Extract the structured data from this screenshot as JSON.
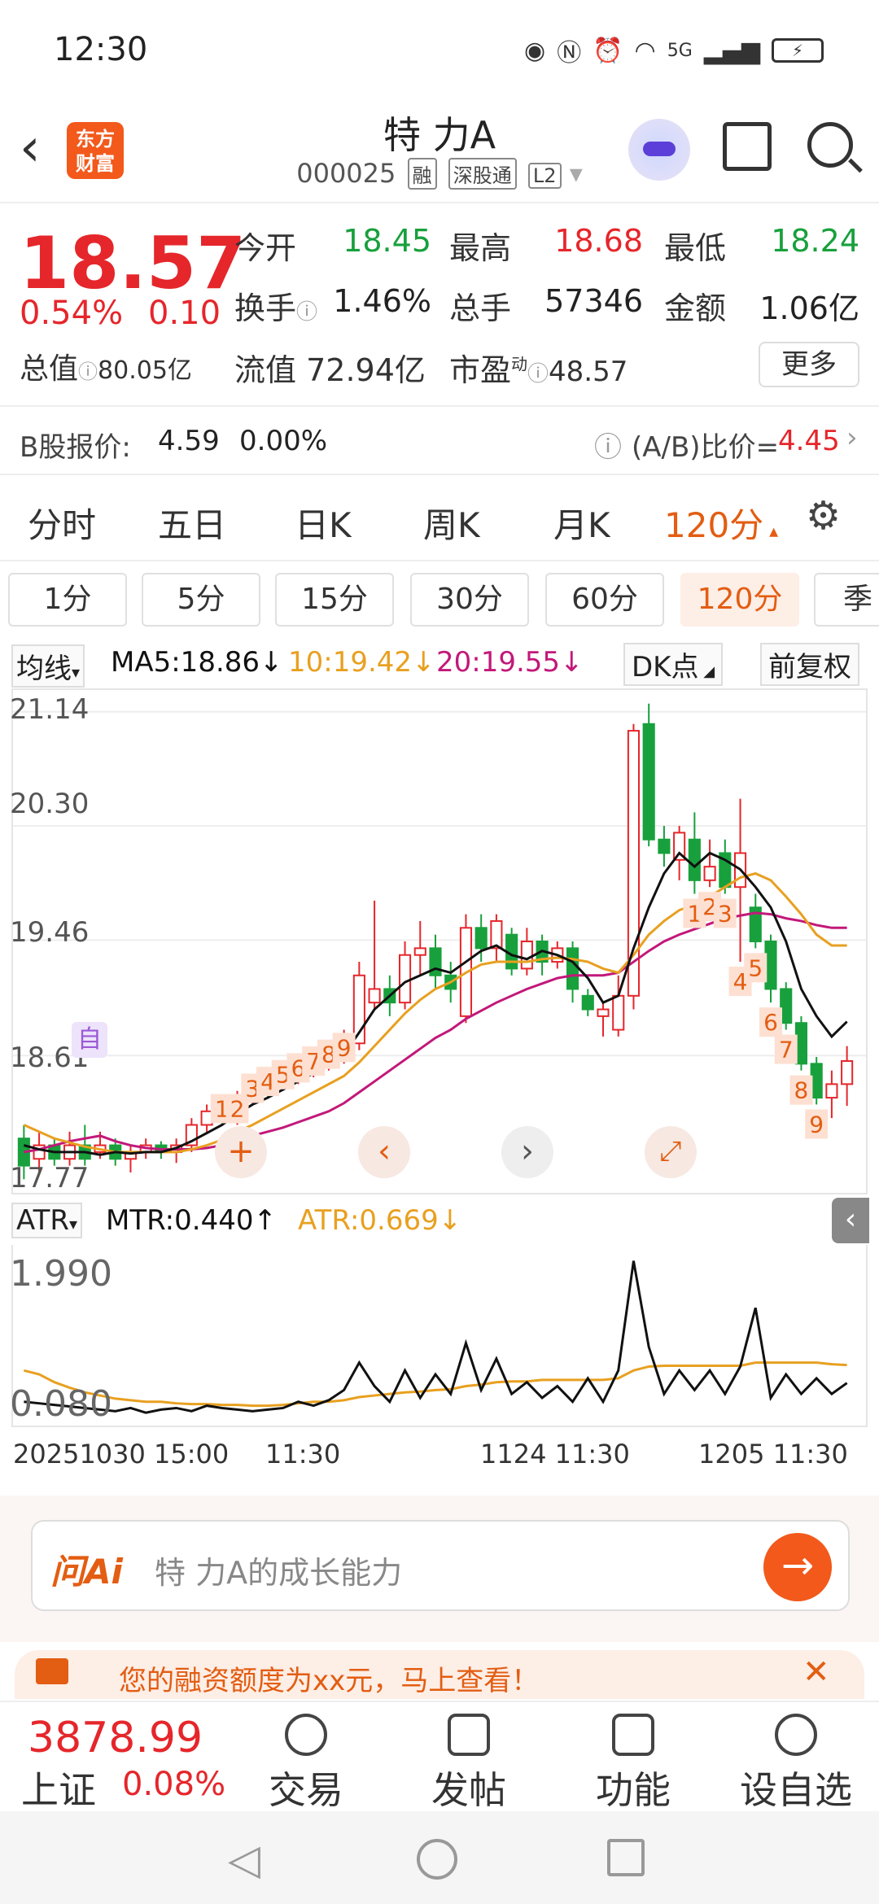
{
  "status": {
    "time": "12:30",
    "net": "5G"
  },
  "header": {
    "title": "特 力A",
    "code": "000025",
    "tags": [
      "融",
      "深股通",
      "L2"
    ],
    "logo": [
      "东方",
      "财富"
    ]
  },
  "quote": {
    "price": "18.57",
    "pct": "0.54%",
    "change": "0.10",
    "fields": [
      {
        "label": "今开",
        "value": "18.45",
        "color": "green"
      },
      {
        "label": "最高",
        "value": "18.68",
        "color": "red"
      },
      {
        "label": "最低",
        "value": "18.24",
        "color": "green"
      },
      {
        "label": "换手",
        "value": "1.46%",
        "color": "dark"
      },
      {
        "label": "总手",
        "value": "57346",
        "color": "dark"
      },
      {
        "label": "金额",
        "value": "1.06亿",
        "color": "dark"
      }
    ],
    "total_value_label": "总值",
    "total_value": "80.05亿",
    "float_label": "流值",
    "float_value": "72.94亿",
    "pe_label": "市盈",
    "pe_sup": "动",
    "pe_value": "48.57",
    "more": "更多"
  },
  "bshare": {
    "label": "B股报价:",
    "price": "4.59",
    "pct": "0.00%",
    "ratio_label": "(A/B)比价=",
    "ratio": "4.45"
  },
  "tabs": [
    "分时",
    "五日",
    "日K",
    "周K",
    "月K",
    "120分"
  ],
  "active_tab": "120分",
  "subtabs": [
    "1分",
    "5分",
    "15分",
    "30分",
    "60分",
    "120分",
    "季"
  ],
  "ma_legend": {
    "selector": "均线",
    "ma5": "MA5:18.86",
    "ma5_arrow": "↓",
    "ma10": "10:19.42",
    "ma10_arrow": "↓",
    "ma20": "20:19.55",
    "ma20_arrow": "↓",
    "dk": "DK点",
    "fq": "前复权"
  },
  "price_axis": [
    "21.14",
    "20.30",
    "19.46",
    "18.61",
    "17.77"
  ],
  "self_mark": "自",
  "atr_legend": {
    "selector": "ATR",
    "mtr": "MTR:0.440",
    "mtr_arrow": "↑",
    "atr": "ATR:0.669",
    "atr_arrow": "↓"
  },
  "atr_axis": [
    "1.990",
    "0.080"
  ],
  "x_labels": [
    "20251030 15:00",
    "11:30",
    "1124 11:30",
    "1205 11:30"
  ],
  "ask": {
    "brand": "问Ai",
    "placeholder": "特 力A的成长能力"
  },
  "ad": {
    "text": "您的融资额度为xx元，马上查看！"
  },
  "index": {
    "value": "3878.99",
    "name": "上证",
    "pct": "0.08%"
  },
  "nav": [
    "交易",
    "发帖",
    "功能",
    "设自选"
  ],
  "colors": {
    "up": "#e5262b",
    "down": "#18a03c",
    "ma5": "#111111",
    "ma10": "#e8a020",
    "ma20": "#c2187a",
    "accent": "#e35d12"
  },
  "chart_data": {
    "type": "candlestick",
    "ylim": [
      17.6,
      21.3
    ],
    "candles": [
      [
        18.0,
        17.8,
        18.1,
        17.7
      ],
      [
        17.85,
        17.95,
        18.05,
        17.75
      ],
      [
        17.95,
        17.85,
        18.0,
        17.8
      ],
      [
        17.85,
        17.95,
        18.05,
        17.8
      ],
      [
        17.95,
        17.85,
        18.1,
        17.8
      ],
      [
        17.9,
        17.95,
        18.05,
        17.85
      ],
      [
        17.95,
        17.85,
        18.0,
        17.8
      ],
      [
        17.85,
        17.9,
        17.95,
        17.75
      ],
      [
        17.9,
        17.95,
        18.0,
        17.85
      ],
      [
        17.95,
        17.9,
        17.98,
        17.85
      ],
      [
        17.9,
        17.95,
        18.0,
        17.82
      ],
      [
        17.95,
        18.1,
        18.15,
        17.9
      ],
      [
        18.1,
        18.2,
        18.25,
        18.05
      ],
      [
        18.2,
        18.15,
        18.3,
        18.1
      ],
      [
        18.15,
        18.3,
        18.35,
        18.1
      ],
      [
        18.3,
        18.4,
        18.45,
        18.25
      ],
      [
        18.4,
        18.38,
        18.5,
        18.3
      ],
      [
        18.38,
        18.45,
        18.55,
        18.35
      ],
      [
        18.45,
        18.5,
        18.6,
        18.4
      ],
      [
        18.5,
        18.55,
        18.6,
        18.45
      ],
      [
        18.55,
        18.6,
        18.7,
        18.5
      ],
      [
        18.6,
        18.7,
        18.8,
        18.55
      ],
      [
        18.7,
        19.2,
        19.3,
        18.65
      ],
      [
        19.0,
        19.1,
        19.75,
        18.95
      ],
      [
        19.1,
        19.0,
        19.2,
        18.9
      ],
      [
        19.0,
        19.35,
        19.45,
        18.95
      ],
      [
        19.35,
        19.4,
        19.6,
        19.2
      ],
      [
        19.4,
        19.2,
        19.5,
        19.1
      ],
      [
        19.2,
        19.1,
        19.3,
        19.0
      ],
      [
        18.9,
        19.55,
        19.65,
        18.85
      ],
      [
        19.55,
        19.4,
        19.65,
        19.3
      ],
      [
        19.4,
        19.6,
        19.65,
        19.3
      ],
      [
        19.5,
        19.25,
        19.55,
        19.2
      ],
      [
        19.25,
        19.45,
        19.55,
        19.2
      ],
      [
        19.45,
        19.3,
        19.5,
        19.2
      ],
      [
        19.3,
        19.4,
        19.45,
        19.25
      ],
      [
        19.4,
        19.1,
        19.45,
        19.0
      ],
      [
        19.05,
        18.95,
        19.1,
        18.9
      ],
      [
        18.9,
        18.95,
        19.0,
        18.75
      ],
      [
        18.8,
        19.05,
        19.2,
        18.75
      ],
      [
        19.05,
        21.0,
        21.05,
        18.95
      ],
      [
        21.05,
        20.2,
        21.2,
        20.15
      ],
      [
        20.2,
        20.1,
        20.3,
        20.0
      ],
      [
        20.05,
        20.25,
        20.3,
        19.9
      ],
      [
        20.2,
        19.9,
        20.4,
        19.8
      ],
      [
        19.9,
        20.0,
        20.2,
        19.85
      ],
      [
        20.1,
        19.85,
        20.2,
        19.8
      ],
      [
        19.85,
        20.1,
        20.5,
        19.3
      ],
      [
        19.7,
        19.45,
        19.8,
        19.4
      ],
      [
        19.45,
        19.1,
        19.5,
        19.0
      ],
      [
        19.1,
        18.85,
        19.15,
        18.8
      ],
      [
        18.85,
        18.55,
        18.9,
        18.5
      ],
      [
        18.55,
        18.3,
        18.6,
        18.25
      ],
      [
        18.3,
        18.4,
        18.5,
        18.15
      ],
      [
        18.4,
        18.57,
        18.68,
        18.24
      ]
    ],
    "ma5": [
      17.95,
      17.92,
      17.9,
      17.9,
      17.9,
      17.88,
      17.9,
      17.89,
      17.9,
      17.9,
      17.93,
      17.98,
      18.04,
      18.1,
      18.18,
      18.25,
      18.3,
      18.36,
      18.42,
      18.48,
      18.55,
      18.62,
      18.78,
      18.95,
      19.05,
      19.15,
      19.2,
      19.25,
      19.22,
      19.3,
      19.38,
      19.42,
      19.35,
      19.32,
      19.38,
      19.35,
      19.3,
      19.18,
      19.0,
      19.05,
      19.4,
      19.7,
      19.95,
      20.1,
      20.0,
      20.1,
      20.05,
      19.98,
      19.85,
      19.7,
      19.45,
      19.1,
      18.9,
      18.75,
      18.86
    ],
    "ma10": [
      18.1,
      18.05,
      18.0,
      17.97,
      17.94,
      17.92,
      17.9,
      17.9,
      17.9,
      17.9,
      17.9,
      17.92,
      17.95,
      17.99,
      18.05,
      18.1,
      18.16,
      18.22,
      18.28,
      18.34,
      18.4,
      18.46,
      18.56,
      18.68,
      18.8,
      18.92,
      19.02,
      19.1,
      19.15,
      19.22,
      19.28,
      19.3,
      19.3,
      19.3,
      19.32,
      19.33,
      19.32,
      19.3,
      19.25,
      19.22,
      19.35,
      19.5,
      19.6,
      19.68,
      19.72,
      19.78,
      19.85,
      19.92,
      19.95,
      19.9,
      19.78,
      19.65,
      19.5,
      19.42,
      19.42
    ],
    "ma20": [
      17.9,
      17.92,
      17.95,
      17.98,
      18.0,
      18.02,
      17.98,
      17.95,
      17.93,
      17.92,
      17.92,
      17.92,
      17.93,
      17.95,
      17.98,
      18.02,
      18.05,
      18.08,
      18.12,
      18.16,
      18.2,
      18.26,
      18.34,
      18.42,
      18.5,
      18.58,
      18.66,
      18.74,
      18.8,
      18.88,
      18.94,
      19.0,
      19.05,
      19.1,
      19.14,
      19.18,
      19.2,
      19.2,
      19.2,
      19.22,
      19.3,
      19.38,
      19.45,
      19.5,
      19.54,
      19.58,
      19.62,
      19.64,
      19.66,
      19.65,
      19.62,
      19.6,
      19.57,
      19.55,
      19.55
    ],
    "markers_up": [
      [
        13,
        "1"
      ],
      [
        14,
        "2"
      ],
      [
        15,
        "3"
      ],
      [
        16,
        "4"
      ],
      [
        17,
        "5"
      ],
      [
        18,
        "6"
      ],
      [
        19,
        "7"
      ],
      [
        20,
        "8"
      ],
      [
        21,
        "9"
      ]
    ],
    "markers_down": [
      [
        44,
        "1"
      ],
      [
        45,
        "2"
      ],
      [
        46,
        "3"
      ],
      [
        47,
        "4"
      ],
      [
        48,
        "5"
      ],
      [
        49,
        "6"
      ],
      [
        50,
        "7"
      ],
      [
        51,
        "8"
      ],
      [
        52,
        "9"
      ]
    ],
    "atr_ylim": [
      0.0,
      2.1
    ],
    "mtr": [
      0.2,
      0.18,
      0.16,
      0.14,
      0.12,
      0.1,
      0.08,
      0.12,
      0.06,
      0.1,
      0.12,
      0.08,
      0.15,
      0.12,
      0.1,
      0.08,
      0.1,
      0.12,
      0.2,
      0.15,
      0.22,
      0.35,
      0.7,
      0.4,
      0.2,
      0.6,
      0.25,
      0.55,
      0.3,
      0.95,
      0.35,
      0.75,
      0.3,
      0.45,
      0.25,
      0.4,
      0.2,
      0.5,
      0.2,
      0.6,
      2.0,
      0.9,
      0.3,
      0.6,
      0.35,
      0.6,
      0.3,
      0.65,
      1.4,
      0.25,
      0.55,
      0.3,
      0.5,
      0.3,
      0.44
    ],
    "atr": [
      0.6,
      0.55,
      0.45,
      0.38,
      0.32,
      0.28,
      0.24,
      0.22,
      0.2,
      0.2,
      0.18,
      0.17,
      0.17,
      0.16,
      0.16,
      0.15,
      0.15,
      0.16,
      0.18,
      0.2,
      0.2,
      0.22,
      0.26,
      0.28,
      0.3,
      0.32,
      0.33,
      0.35,
      0.36,
      0.4,
      0.42,
      0.45,
      0.46,
      0.46,
      0.48,
      0.48,
      0.48,
      0.48,
      0.48,
      0.5,
      0.6,
      0.65,
      0.66,
      0.66,
      0.66,
      0.66,
      0.66,
      0.66,
      0.7,
      0.7,
      0.7,
      0.7,
      0.7,
      0.68,
      0.669
    ]
  }
}
